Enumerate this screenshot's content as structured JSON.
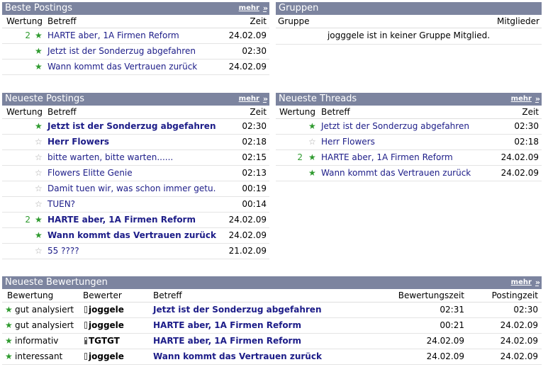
{
  "beste": {
    "title": "Beste Postings",
    "more": "mehr",
    "cols": {
      "wertung": "Wertung",
      "betreff": "Betreff",
      "zeit": "Zeit"
    },
    "rows": [
      {
        "count": "2",
        "title": "HARTE aber, 1A Firmen Reform",
        "time": "24.02.09"
      },
      {
        "count": "",
        "title": "Jetzt ist der Sonderzug abgefahren",
        "time": "02:30"
      },
      {
        "count": "",
        "title": "Wann kommt das Vertrauen zurück",
        "time": "24.02.09"
      }
    ]
  },
  "gruppen": {
    "title": "Gruppen",
    "cols": {
      "gruppe": "Gruppe",
      "mitglieder": "Mitglieder"
    },
    "empty_message": "jogggele ist in keiner Gruppe Mitglied."
  },
  "neueste_postings": {
    "title": "Neueste Postings",
    "more": "mehr",
    "cols": {
      "wertung": "Wertung",
      "betreff": "Betreff",
      "zeit": "Zeit"
    },
    "rows": [
      {
        "count": "",
        "title": "Jetzt ist der Sonderzug abgefahren",
        "time": "02:30"
      },
      {
        "count": "",
        "title": "Herr Flowers",
        "time": "02:18"
      },
      {
        "count": "",
        "title": "bitte warten, bitte warten......",
        "time": "02:15"
      },
      {
        "count": "",
        "title": "Flowers Elitte Genie",
        "time": "02:13"
      },
      {
        "count": "",
        "title": "Damit tuen wir, was schon immer getu.",
        "time": "00:19"
      },
      {
        "count": "",
        "title": "TUEN?",
        "time": "00:14"
      },
      {
        "count": "2",
        "title": "HARTE aber, 1A Firmen Reform",
        "time": "24.02.09"
      },
      {
        "count": "",
        "title": "Wann kommt das Vertrauen zurück",
        "time": "24.02.09"
      },
      {
        "count": "",
        "title": "55 ????",
        "time": "21.02.09"
      }
    ]
  },
  "neueste_threads": {
    "title": "Neueste Threads",
    "more": "mehr",
    "cols": {
      "wertung": "Wertung",
      "betreff": "Betreff",
      "zeit": "Zeit"
    },
    "rows": [
      {
        "count": "",
        "title": "Jetzt ist der Sonderzug abgefahren",
        "time": "02:30"
      },
      {
        "count": "",
        "title": "Herr Flowers",
        "time": "02:18"
      },
      {
        "count": "2",
        "title": "HARTE aber, 1A Firmen Reform",
        "time": "24.02.09"
      },
      {
        "count": "",
        "title": "Wann kommt das Vertrauen zurück",
        "time": "24.02.09"
      }
    ]
  },
  "bewertungen": {
    "title": "Neueste Bewertungen",
    "more": "mehr",
    "cols": {
      "bewertung": "Bewertung",
      "bewerter": "Bewerter",
      "betreff": "Betreff",
      "bewertungszeit": "Bewertungszeit",
      "postingzeit": "Postingzeit"
    },
    "rows": [
      {
        "rating": "gut analysiert",
        "user": "joggele",
        "title": "Jetzt ist der Sonderzug abgefahren",
        "rated": "02:31",
        "posted": "02:30"
      },
      {
        "rating": "gut analysiert",
        "user": "joggele",
        "title": "HARTE aber, 1A Firmen Reform",
        "rated": "00:21",
        "posted": "24.02.09"
      },
      {
        "rating": "informativ",
        "user": "TGTGT",
        "title": "HARTE aber, 1A Firmen Reform",
        "rated": "24.02.09",
        "posted": "24.02.09"
      },
      {
        "rating": "interessant",
        "user": "joggele",
        "title": "Wann kommt das Vertrauen zurück",
        "rated": "24.02.09",
        "posted": "24.02.09"
      }
    ]
  },
  "colors": {
    "header_bg": "#7c849f",
    "link": "#1c1c88",
    "star": "#2e9a2e",
    "star_empty": "#a9a9a9"
  },
  "icons": {
    "rated": "star-filled-icon",
    "unrated": "star-outline-icon",
    "multi_rated": "star-multi-icon",
    "user": "user-icon"
  }
}
